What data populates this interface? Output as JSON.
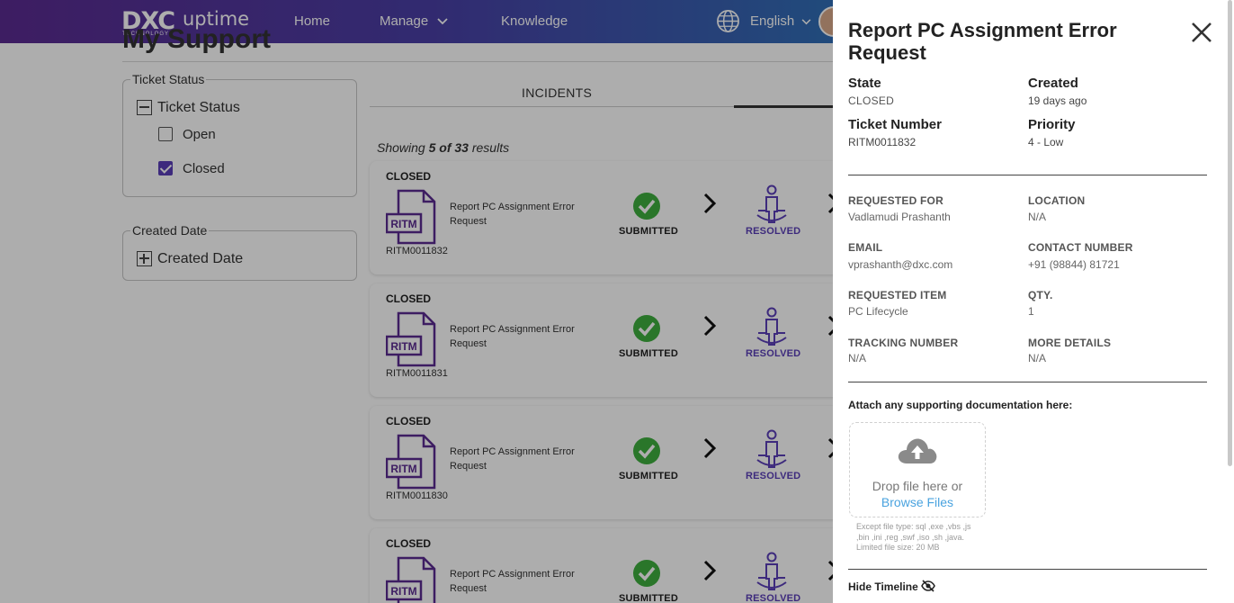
{
  "header": {
    "logo_main": "DXC",
    "logo_sub": "TECHNOLOGY",
    "logo_product": "uptime",
    "nav": [
      "Home",
      "Manage",
      "Knowledge"
    ],
    "language": "English"
  },
  "page": {
    "title": "My Support",
    "filters": {
      "ticket_status": {
        "legend": "Ticket Status",
        "heading": "Ticket Status",
        "options": [
          {
            "label": "Open",
            "checked": false
          },
          {
            "label": "Closed",
            "checked": true
          }
        ]
      },
      "created_date": {
        "legend": "Created Date",
        "heading": "Created Date"
      }
    },
    "tabs": [
      "INCIDENTS"
    ],
    "showing_prefix": "Showing ",
    "showing_count": "5 of 33",
    "showing_suffix": " results",
    "tickets": [
      {
        "status": "CLOSED",
        "icon_text": "RITM",
        "number": "RITM0011832",
        "title": "Report PC Assignment Error Request",
        "step1": "SUBMITTED",
        "step2": "RESOLVED"
      },
      {
        "status": "CLOSED",
        "icon_text": "RITM",
        "number": "RITM0011831",
        "title": "Report PC Assignment Error Request",
        "step1": "SUBMITTED",
        "step2": "RESOLVED"
      },
      {
        "status": "CLOSED",
        "icon_text": "RITM",
        "number": "RITM0011830",
        "title": "Report PC Assignment Error Request",
        "step1": "SUBMITTED",
        "step2": "RESOLVED"
      },
      {
        "status": "CLOSED",
        "icon_text": "RITM",
        "number": "",
        "title": "Report PC Assignment Error Request",
        "step1": "SUBMITTED",
        "step2": "RESOLVED"
      }
    ]
  },
  "panel": {
    "title": "Report PC Assignment Error Request",
    "state_label": "State",
    "state_value": "CLOSED",
    "created_label": "Created",
    "created_value": "19 days ago",
    "ticket_number_label": "Ticket Number",
    "ticket_number_value": "RITM0011832",
    "priority_label": "Priority",
    "priority_value": "4 - Low",
    "requested_for_label": "REQUESTED FOR",
    "requested_for_value": "Vadlamudi Prashanth",
    "location_label": "LOCATION",
    "location_value": "N/A",
    "email_label": "EMAIL",
    "email_value": "vprashanth@dxc.com",
    "contact_label": "CONTACT NUMBER",
    "contact_value": "+91 (98844) 81721",
    "requested_item_label": "REQUESTED ITEM",
    "requested_item_value": "PC Lifecycle",
    "qty_label": "QTY.",
    "qty_value": "1",
    "tracking_label": "TRACKING NUMBER",
    "tracking_value": "N/A",
    "more_details_label": "MORE DETAILS",
    "more_details_value": "N/A",
    "attach_title": "Attach any supporting documentation here:",
    "drop_text": "Drop file here or",
    "browse_text": "Browse Files",
    "hint_line1": "Except file type: sql ,exe ,vbs ,js",
    "hint_line2": ",bin ,ini ,reg ,swf ,iso ,sh ,java.",
    "hint_line3": "Limited file size: 20 MB",
    "hide_timeline": "Hide Timeline"
  },
  "colors": {
    "brand_purple": "#5b2b91",
    "step_green": "#3fae3f",
    "resolved_purple": "#5a3fb8",
    "browse_link": "#4aa3df"
  }
}
